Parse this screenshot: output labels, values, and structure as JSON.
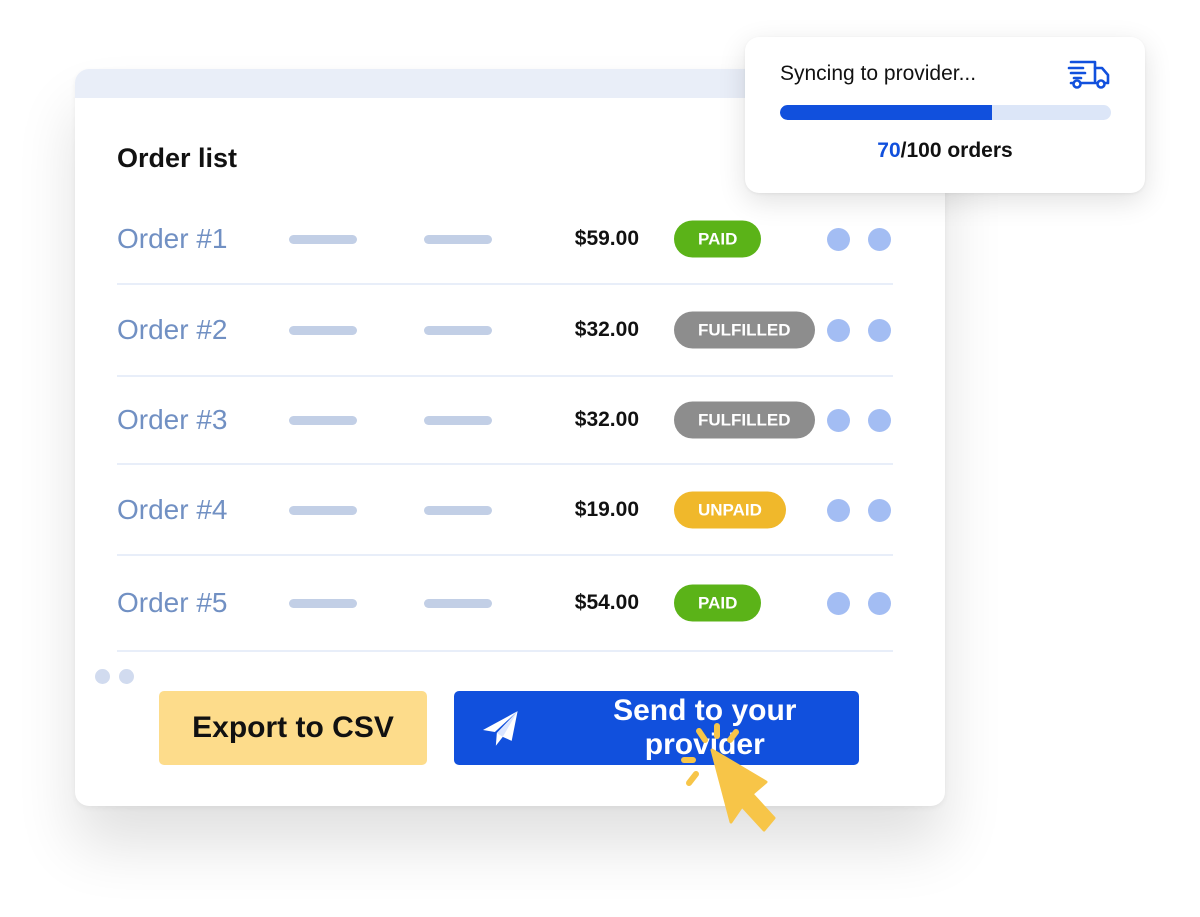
{
  "order_list": {
    "title": "Order list",
    "rows": [
      {
        "name": "Order #1",
        "price": "$59.00",
        "status": "PAID",
        "status_color": "#5bb318"
      },
      {
        "name": "Order #2",
        "price": "$32.00",
        "status": "FULFILLED",
        "status_color": "#8d8d8d"
      },
      {
        "name": "Order #3",
        "price": "$32.00",
        "status": "FULFILLED",
        "status_color": "#8d8d8d"
      },
      {
        "name": "Order #4",
        "price": "$19.00",
        "status": "UNPAID",
        "status_color": "#f0b82b"
      },
      {
        "name": "Order #5",
        "price": "$54.00",
        "status": "PAID",
        "status_color": "#5bb318"
      }
    ]
  },
  "actions": {
    "export_label": "Export to CSV",
    "send_label": "Send to your provider",
    "send_icon": "paper-plane-icon"
  },
  "sync": {
    "title": "Syncing to provider...",
    "icon": "delivery-truck-icon",
    "done": "70",
    "total_text": "/100 orders",
    "progress_percent": 64
  },
  "colors": {
    "accent": "#1150dd",
    "export_button": "#fddc8b",
    "cursor": "#f7c548"
  }
}
